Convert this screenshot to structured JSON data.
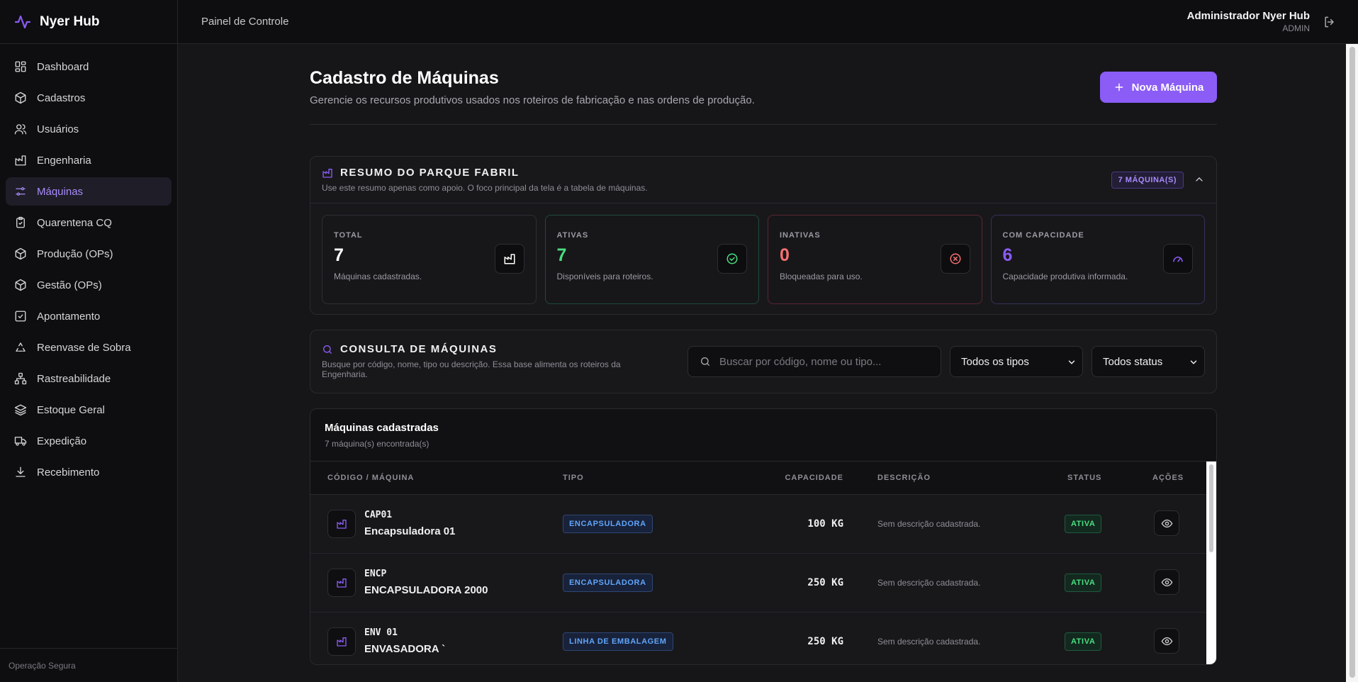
{
  "brand": {
    "name": "Nyer Hub"
  },
  "sidebar": {
    "items": [
      {
        "label": "Dashboard",
        "icon": "dashboard-icon"
      },
      {
        "label": "Cadastros",
        "icon": "box-icon"
      },
      {
        "label": "Usuários",
        "icon": "users-icon"
      },
      {
        "label": "Engenharia",
        "icon": "factory-icon"
      },
      {
        "label": "Máquinas",
        "icon": "sliders-icon",
        "active": true
      },
      {
        "label": "Quarentena CQ",
        "icon": "clipboard-icon"
      },
      {
        "label": "Produção (OPs)",
        "icon": "box-icon"
      },
      {
        "label": "Gestão (OPs)",
        "icon": "box-icon"
      },
      {
        "label": "Apontamento",
        "icon": "check-square-icon"
      },
      {
        "label": "Reenvase de Sobra",
        "icon": "recycle-icon"
      },
      {
        "label": "Rastreabilidade",
        "icon": "network-icon"
      },
      {
        "label": "Estoque Geral",
        "icon": "layers-icon"
      },
      {
        "label": "Expedição",
        "icon": "truck-icon"
      },
      {
        "label": "Recebimento",
        "icon": "download-icon"
      }
    ],
    "footer": "Operação Segura"
  },
  "topbar": {
    "title": "Painel de Controle",
    "user_name": "Administrador Nyer Hub",
    "user_role": "ADMIN"
  },
  "page": {
    "title": "Cadastro de Máquinas",
    "subtitle": "Gerencie os recursos produtivos usados nos roteiros de fabricação e nas ordens de produção.",
    "new_button": "Nova Máquina"
  },
  "summary": {
    "title": "RESUMO DO PARQUE FABRIL",
    "desc": "Use este resumo apenas como apoio. O foco principal da tela é a tabela de máquinas.",
    "badge": "7 MÁQUINA(S)",
    "stats": [
      {
        "label": "TOTAL",
        "value": "7",
        "desc": "Máquinas cadastradas."
      },
      {
        "label": "ATIVAS",
        "value": "7",
        "desc": "Disponíveis para roteiros."
      },
      {
        "label": "INATIVAS",
        "value": "0",
        "desc": "Bloqueadas para uso."
      },
      {
        "label": "COM CAPACIDADE",
        "value": "6",
        "desc": "Capacidade produtiva informada."
      }
    ]
  },
  "filters": {
    "title": "CONSULTA DE MÁQUINAS",
    "desc": "Busque por código, nome, tipo ou descrição. Essa base alimenta os roteiros da Engenharia.",
    "search_placeholder": "Buscar por código, nome ou tipo...",
    "type_select": "Todos os tipos",
    "status_select": "Todos status"
  },
  "table": {
    "title": "Máquinas cadastradas",
    "count": "7 máquina(s) encontrada(s)",
    "columns": [
      "CÓDIGO / MÁQUINA",
      "TIPO",
      "CAPACIDADE",
      "DESCRIÇÃO",
      "STATUS",
      "AÇÕES"
    ],
    "rows": [
      {
        "code": "CAP01",
        "name": "Encapsuladora 01",
        "type": "ENCAPSULADORA",
        "capacity": "100 KG",
        "description": "Sem descrição cadastrada.",
        "status": "ATIVA"
      },
      {
        "code": "ENCP",
        "name": "ENCAPSULADORA 2000",
        "type": "ENCAPSULADORA",
        "capacity": "250 KG",
        "description": "Sem descrição cadastrada.",
        "status": "ATIVA"
      },
      {
        "code": "ENV 01",
        "name": "ENVASADORA `",
        "type": "LINHA DE EMBALAGEM",
        "capacity": "250 KG",
        "description": "Sem descrição cadastrada.",
        "status": "ATIVA"
      }
    ]
  },
  "colors": {
    "accent": "#8b5cf6",
    "active_text": "#a78bfa",
    "green": "#4ade80",
    "red": "#f87171",
    "blue": "#60a5fa",
    "background": "#161618",
    "sidebar": "#0e0e10"
  }
}
